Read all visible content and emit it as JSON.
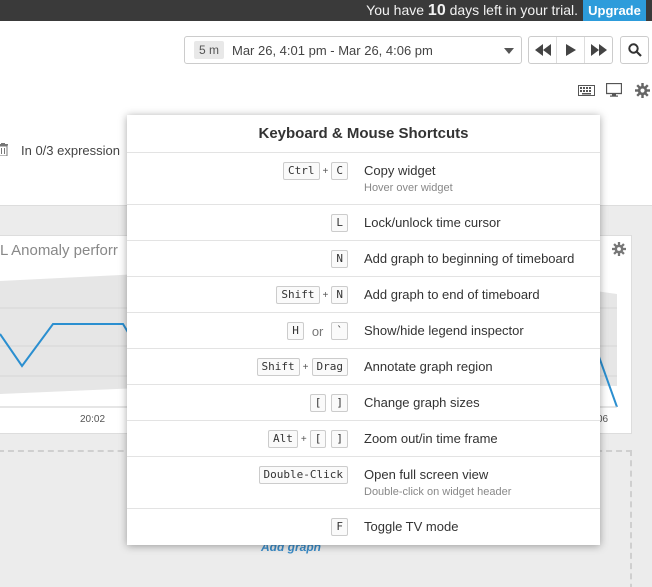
{
  "trial": {
    "prefix": "You have",
    "days": "10",
    "suffix": "days left in your trial.",
    "upgrade_label": "Upgrade"
  },
  "timeframe": {
    "span": "5 m",
    "range": "Mar 26, 4:01 pm - Mar 26, 4:06 pm"
  },
  "toolbar": {
    "keyboard_icon": "keyboard-icon",
    "monitor_icon": "monitor-icon",
    "gear_icon": "gear-icon"
  },
  "expressions": {
    "text": "In 0/3 expression"
  },
  "widget": {
    "title": "L Anomaly perforr",
    "x_ticks": {
      "first": "20:02",
      "last": "06"
    }
  },
  "add_graph_label": "Add graph",
  "shortcuts": {
    "title": "Keyboard & Mouse Shortcuts",
    "or_label": "or",
    "plus": "+",
    "items": [
      {
        "keys": [
          "Ctrl",
          "C"
        ],
        "action": "Copy widget",
        "hint": "Hover over widget"
      },
      {
        "keys": [
          "L"
        ],
        "action": "Lock/unlock time cursor"
      },
      {
        "keys": [
          "N"
        ],
        "action": "Add graph to beginning of timeboard"
      },
      {
        "keys": [
          "Shift",
          "N"
        ],
        "action": "Add graph to end of timeboard"
      },
      {
        "keys": [
          "H",
          "`"
        ],
        "action": "Show/hide legend inspector"
      },
      {
        "keys": [
          "Shift",
          "Drag"
        ],
        "action": "Annotate graph region"
      },
      {
        "keys": [
          "[",
          "]"
        ],
        "action": "Change graph sizes"
      },
      {
        "keys": [
          "Alt",
          "[",
          "]"
        ],
        "action": "Zoom out/in time frame"
      },
      {
        "keys": [
          "Double-Click"
        ],
        "action": "Open full screen view",
        "hint": "Double-click on widget header"
      },
      {
        "keys": [
          "F"
        ],
        "action": "Toggle TV mode"
      }
    ]
  },
  "colors": {
    "accent": "#2d9cdb",
    "series_line": "#2b8fd0",
    "band": "#e6e6e6",
    "banner_bg": "#3a3a3a"
  }
}
